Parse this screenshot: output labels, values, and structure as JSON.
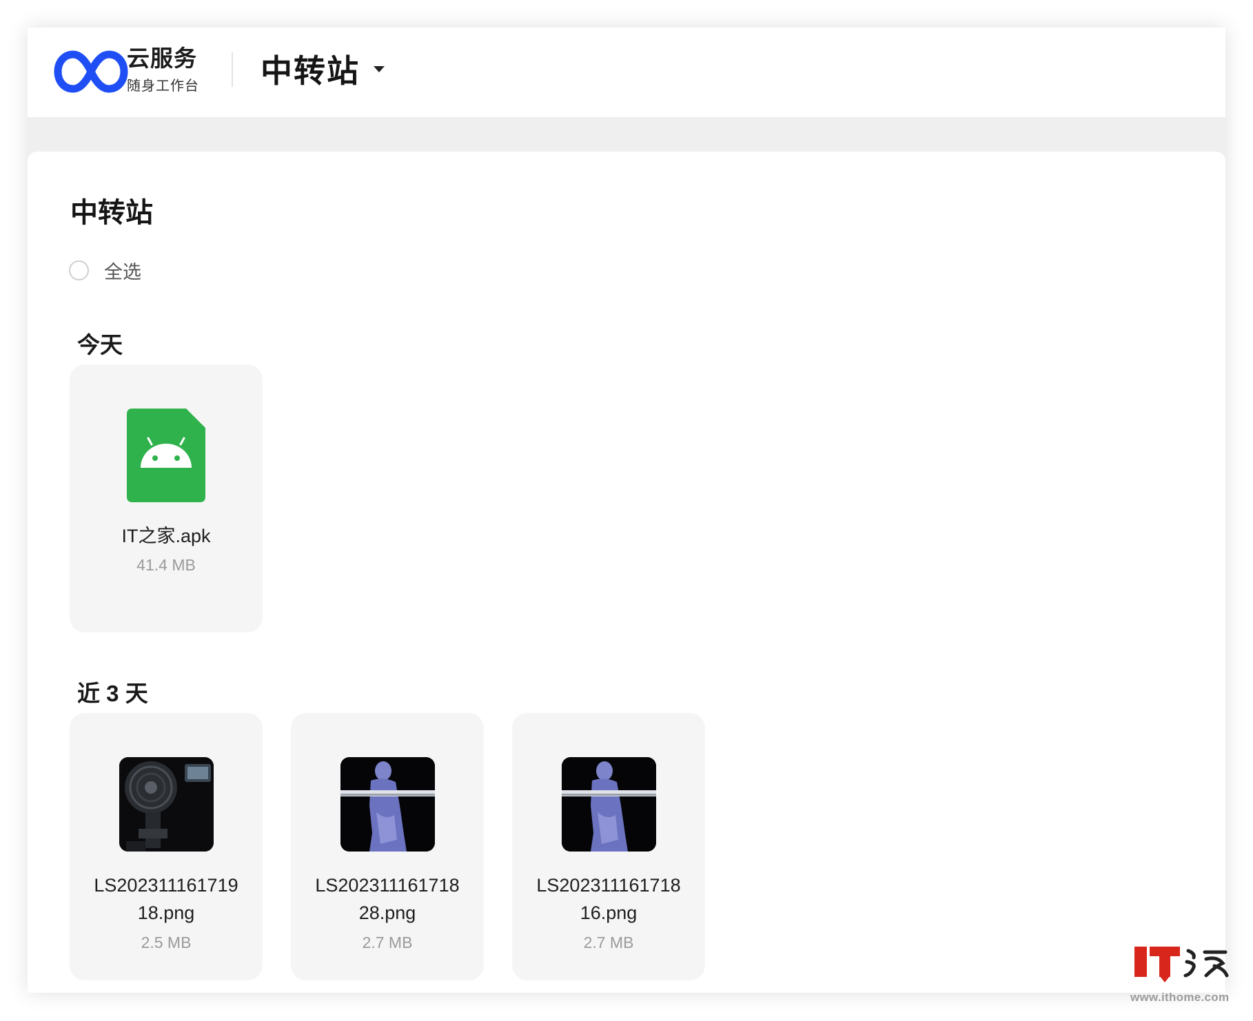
{
  "app": {
    "brand_name": "云服务",
    "brand_sub": "随身工作台",
    "section_switcher": "中转站"
  },
  "page": {
    "title": "中转站",
    "select_all": "全选"
  },
  "groups": [
    {
      "title": "今天",
      "files": [
        {
          "name": "IT之家.apk",
          "size": "41.4 MB",
          "icon": "android-apk-icon"
        }
      ]
    },
    {
      "title": "近 3 天",
      "files": [
        {
          "name_line1": "LS202311161719",
          "name_line2": "18.png",
          "size": "2.5 MB",
          "icon": "image-thumbnail"
        },
        {
          "name_line1": "LS202311161718",
          "name_line2": "28.png",
          "size": "2.7 MB",
          "icon": "image-thumbnail"
        },
        {
          "name_line1": "LS202311161718",
          "name_line2": "16.png",
          "size": "2.7 MB",
          "icon": "image-thumbnail"
        }
      ]
    }
  ],
  "watermark": {
    "logo_text": "IT之家",
    "url": "www.ithome.com"
  },
  "colors": {
    "brand_blue": "#1f4ef5",
    "apk_green": "#2fb24b",
    "card_bg": "#f5f5f5",
    "watermark_red": "#d9261c"
  }
}
